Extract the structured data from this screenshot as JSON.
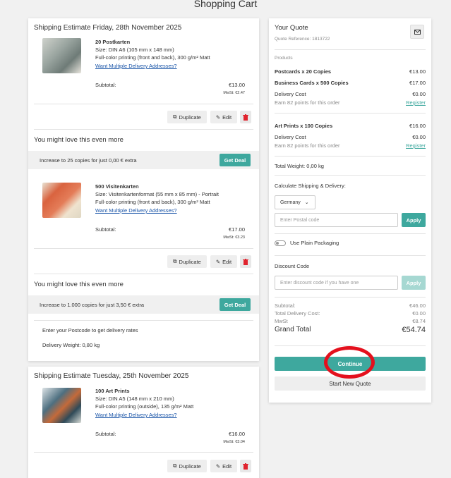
{
  "page_title": "Shopping Cart",
  "shipping1": {
    "heading": "Shipping Estimate Friday, 28th November 2025",
    "items": [
      {
        "name": "20 Postkarten",
        "size": "Size: DIN A6 (105 mm x 148 mm)",
        "printing": "Full-color printing (front and back), 300 g/m² Matt",
        "link": "Want Multiple Delivery Addresses?",
        "subtotal_label": "Subtotal:",
        "subtotal": "€13.00",
        "vat": "MwSt: €2.47",
        "duplicate": "Duplicate",
        "edit": "Edit"
      },
      {
        "name": "500 Visitenkarten",
        "size": "Size: Visitenkartenformat (55 mm x 85 mm) - Portrait",
        "printing": "Full-color printing (front and back), 300 g/m² Matt",
        "link": "Want Multiple Delivery Addresses?",
        "subtotal_label": "Subtotal:",
        "subtotal": "€17.00",
        "vat": "MwSt: €3.23",
        "duplicate": "Duplicate",
        "edit": "Edit"
      }
    ],
    "upsells": [
      {
        "title": "You might love this even more",
        "offer": "Increase to 25 copies for just 0,00 € extra",
        "button": "Get Deal"
      },
      {
        "title": "You might love this even more",
        "offer": "Increase to 1.000 copies for just 3,50 € extra",
        "button": "Get Deal"
      }
    ],
    "postcode_note": "Enter your Postcode to get delivery rates",
    "delivery_weight": "Delivery Weight: 0,80 kg"
  },
  "shipping2": {
    "heading": "Shipping Estimate Tuesday, 25th November 2025",
    "item": {
      "name": "100 Art Prints",
      "size": "Size: DIN A5 (148 mm x 210 mm)",
      "printing": "Full-color printing (outside), 135 g/m² Matt",
      "link": "Want Multiple Delivery Addresses?",
      "subtotal_label": "Subtotal:",
      "subtotal": "€16.00",
      "vat": "MwSt: €3.04",
      "duplicate": "Duplicate",
      "edit": "Edit"
    }
  },
  "quote": {
    "title": "Your Quote",
    "reference": "Quote Reference: 1813722",
    "products_label": "Products",
    "lines": [
      {
        "label": "Postcards x 20 Copies",
        "value": "€13.00"
      },
      {
        "label": "Business Cards x 500 Copies",
        "value": "€17.00"
      }
    ],
    "delivery_cost_label": "Delivery Cost",
    "delivery_cost_1": "€0.00",
    "earn_points": "Earn 82 points for this order",
    "register": "Register",
    "art_line": {
      "label": "Art Prints x 100 Copies",
      "value": "€16.00"
    },
    "delivery_cost_2": "€0.00",
    "total_weight": "Total Weight: 0,00 kg",
    "calc_label": "Calculate Shipping & Delivery:",
    "country": "Germany",
    "postal_placeholder": "Enter Postal code",
    "apply": "Apply",
    "plain_packaging": "Use Plain Packaging",
    "discount_label": "Discount Code",
    "discount_placeholder": "Enter discount code if you have one",
    "subtotal_label": "Subtotal:",
    "subtotal": "€46.00",
    "total_delivery_label": "Total Delivery Cost:",
    "total_delivery": "€0.00",
    "mwst_label": "MwSt",
    "mwst": "€8.74",
    "grand_total_label": "Grand Total",
    "grand_total": "€54.74",
    "continue": "Continue",
    "new_quote": "Start New Quote"
  },
  "colors": {
    "accent": "#3ea89e",
    "annotation": "#e4101d",
    "link": "#1a55a8"
  }
}
